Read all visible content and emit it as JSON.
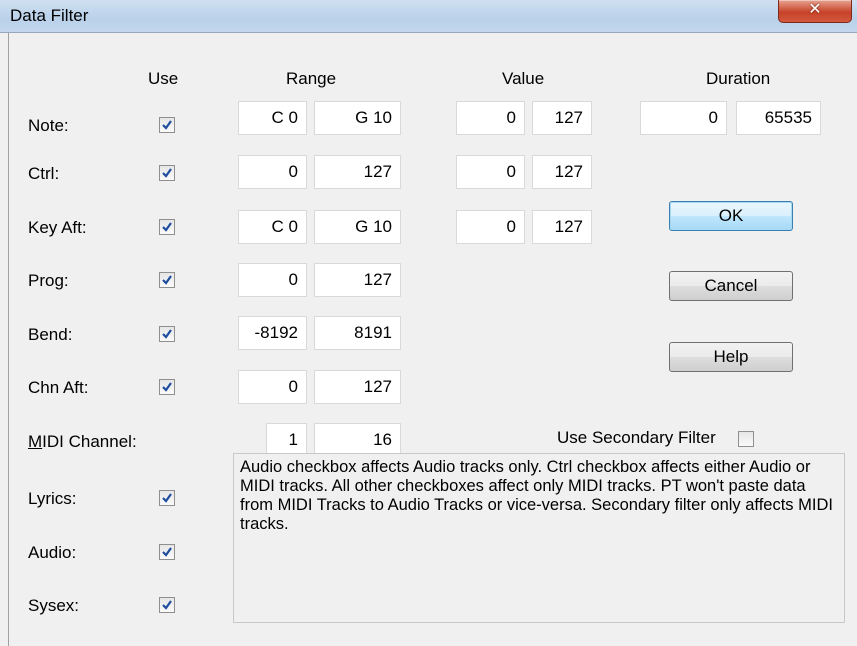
{
  "window": {
    "title": "Data Filter",
    "close_glyph": "✕"
  },
  "headers": {
    "use": "Use",
    "range": "Range",
    "value": "Value",
    "duration": "Duration"
  },
  "rows": [
    {
      "label": "Note:",
      "use_checked": true,
      "range_min": "C 0",
      "range_max": "G 10",
      "value_min": "0",
      "value_max": "127",
      "duration_min": "0",
      "duration_max": "65535"
    },
    {
      "label": "Ctrl:",
      "use_checked": true,
      "range_min": "0",
      "range_max": "127",
      "value_min": "0",
      "value_max": "127"
    },
    {
      "label": "Key Aft:",
      "use_checked": true,
      "range_min": "C 0",
      "range_max": "G 10",
      "value_min": "0",
      "value_max": "127"
    },
    {
      "label": "Prog:",
      "use_checked": true,
      "range_min": "0",
      "range_max": "127"
    },
    {
      "label": "Bend:",
      "use_checked": true,
      "range_min": "-8192",
      "range_max": "8191"
    },
    {
      "label": "Chn Aft:",
      "use_checked": true,
      "range_min": "0",
      "range_max": "127"
    }
  ],
  "midi_channel": {
    "label_accel": "M",
    "label_rest": "IDI Channel:",
    "min": "1",
    "max": "16"
  },
  "secondary_filter": {
    "label": "Use Secondary Filter",
    "checked": false
  },
  "extra_rows": [
    {
      "label": "Lyrics:",
      "checked": true
    },
    {
      "label": "Audio:",
      "checked": true
    },
    {
      "label": "Sysex:",
      "checked": true
    }
  ],
  "buttons": {
    "ok": "OK",
    "cancel": "Cancel",
    "help": "Help"
  },
  "info_text": "Audio checkbox affects Audio tracks only.  Ctrl checkbox affects either Audio or MIDI tracks.   All other checkboxes affect only MIDI tracks.  PT won't paste data from MIDI Tracks to Audio Tracks or vice-versa.  Secondary filter only affects MIDI tracks.",
  "colors": {
    "check_mark": "#1f4e9e",
    "titlebar": "#b9d1ea",
    "close_button": "#c7432a",
    "default_button_border": "#3c7fb1"
  }
}
